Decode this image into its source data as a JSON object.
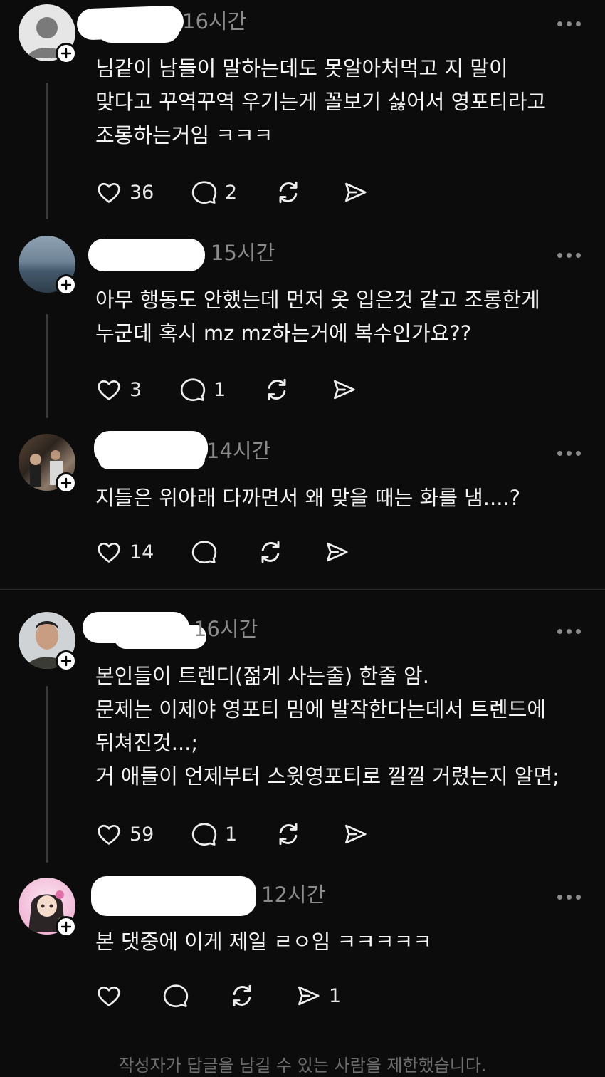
{
  "posts": [
    {
      "time": "16시간",
      "text": "님같이 남들이 말하는데도 못알아처먹고 지 말이\n맞다고 꾸역꾸역 우기는게 꼴보기 싫어서 영포티라고\n조롱하는거임 ㅋㅋㅋ",
      "likes": "36",
      "replies": "2",
      "reposts": "",
      "shares": ""
    },
    {
      "time": "15시간",
      "text": "아무 행동도 안했는데 먼저 옷 입은것 같고 조롱한게\n누군데 혹시 mz mz하는거에 복수인가요??",
      "likes": "3",
      "replies": "1",
      "reposts": "",
      "shares": ""
    },
    {
      "time": "14시간",
      "text": "지들은 위아래 다까면서 왜 맞을 때는 화를 냄....?",
      "likes": "14",
      "replies": "",
      "reposts": "",
      "shares": ""
    },
    {
      "time": "16시간",
      "text": "본인들이 트렌디(젊게 사는줄) 한줄 암.\n문제는 이제야 영포티 밈에 발작한다는데서 트렌드에\n뒤쳐진것...;\n거 애들이 언제부터 스윗영포티로 낄낄 거렸는지 알면;",
      "likes": "59",
      "replies": "1",
      "reposts": "",
      "shares": ""
    },
    {
      "time": "12시간",
      "text": "본 댓중에 이게 제일 ㄹㅇ임 ㅋㅋㅋㅋㅋ",
      "likes": "",
      "replies": "",
      "reposts": "",
      "shares": "1"
    }
  ],
  "footer": "작성자가 답글을 남길 수 있는 사람을 제한했습니다.",
  "icons": {
    "like": "heart-icon",
    "reply": "comment-bubble-icon",
    "repost": "repost-icon",
    "share": "send-icon",
    "more": "more-dots-icon",
    "follow": "plus-icon"
  },
  "colors": {
    "background": "#0c0c0c",
    "text": "#f4f4f4",
    "muted": "#8b8b8b"
  }
}
